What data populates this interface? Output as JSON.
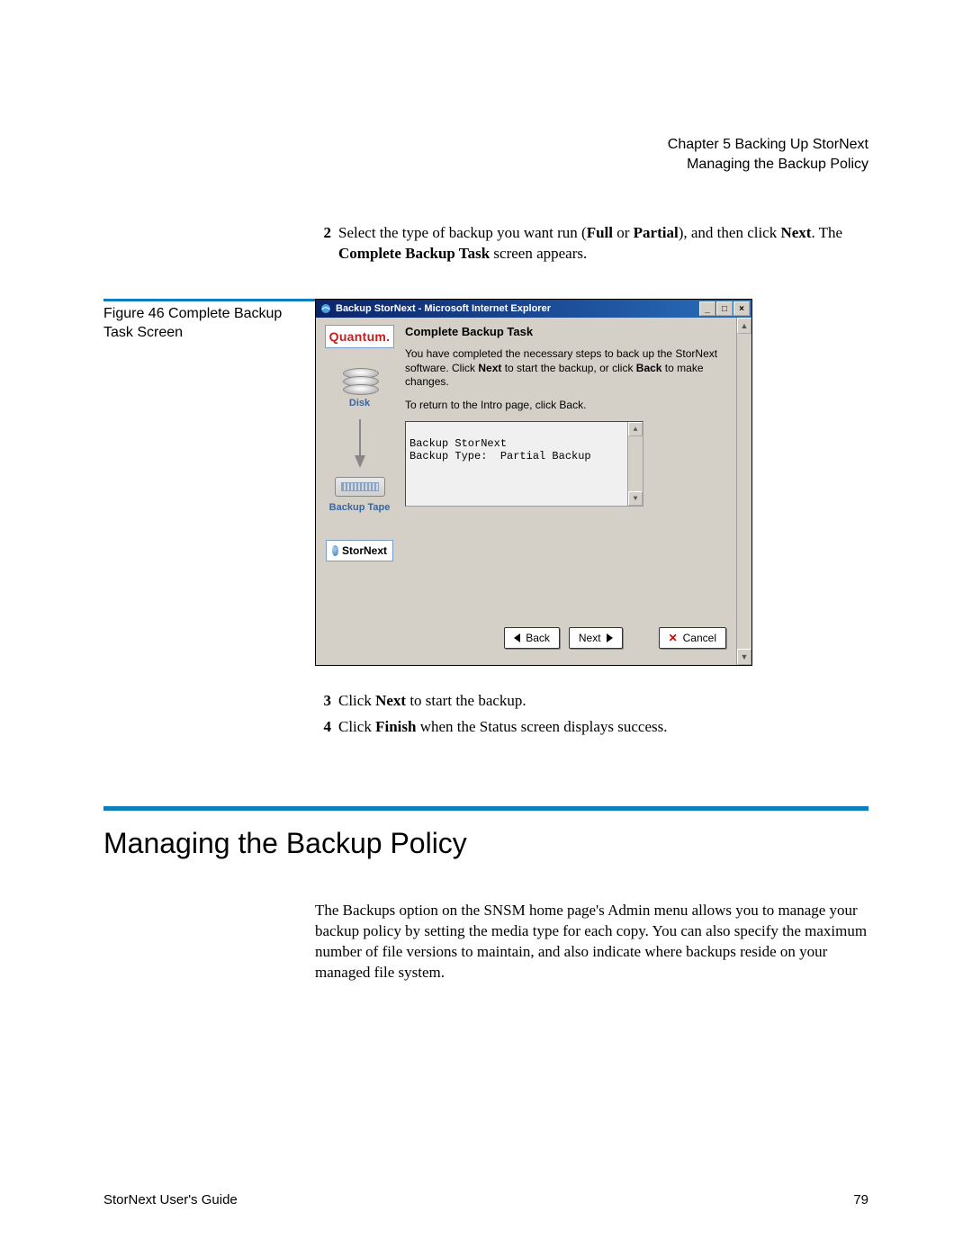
{
  "header": {
    "line1": "Chapter 5  Backing Up StorNext",
    "line2": "Managing the Backup Policy"
  },
  "steps_top": [
    {
      "num": "2",
      "html": "Select the type of backup you want run (<b>Full</b> or <b>Partial</b>), and then click <b>Next</b>. The <b>Complete Backup Task</b> screen appears."
    }
  ],
  "figure": {
    "caption": "Figure 46  Complete Backup Task Screen"
  },
  "win": {
    "title": "Backup StorNext - Microsoft Internet Explorer",
    "btn_min": "_",
    "btn_max": "□",
    "btn_close": "×",
    "sidebar": {
      "brand": "Quantum.",
      "disk_label": "Disk",
      "tape_label": "Backup Tape",
      "product": "StorNext"
    },
    "main": {
      "title": "Complete Backup Task",
      "p1_html": "You have completed the necessary steps to back up the StorNext software. Click <b>Next</b> to start the backup, or click <b>Back</b> to make changes.",
      "p2": "To return to the Intro page, click Back.",
      "summary_line1": "Backup StorNext",
      "summary_line2": "Backup Type:  Partial Backup"
    },
    "buttons": {
      "back": "Back",
      "next": "Next",
      "cancel": "Cancel"
    }
  },
  "steps_bottom": [
    {
      "num": "3",
      "html": "Click <b>Next</b> to start the backup."
    },
    {
      "num": "4",
      "html": "Click <b>Finish</b> when the Status screen displays success."
    }
  ],
  "section": {
    "heading": "Managing the Backup Policy",
    "body": "The Backups option on the SNSM home page's Admin menu allows you to manage your backup policy by setting the media type for each copy. You can also specify the maximum number of file versions to maintain, and also indicate where backups reside on your managed file system."
  },
  "footer": {
    "left": "StorNext User's Guide",
    "right": "79"
  }
}
